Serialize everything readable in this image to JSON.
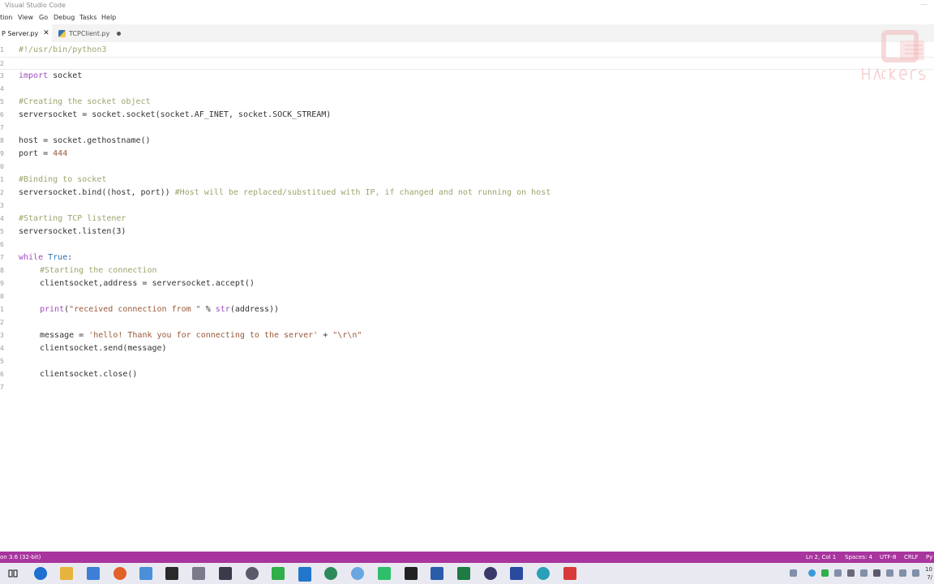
{
  "window": {
    "title": "Visual Studio Code",
    "control": "—"
  },
  "menu": [
    {
      "label": "tion"
    },
    {
      "label": "View"
    },
    {
      "label": "Go"
    },
    {
      "label": "Debug"
    },
    {
      "label": "Tasks"
    },
    {
      "label": "Help"
    }
  ],
  "tabs": [
    {
      "label": "P Server.py",
      "close": "✕",
      "active": true
    },
    {
      "label": "TCPClient.py",
      "dirty": true,
      "active": false
    }
  ],
  "editor": {
    "lines": [
      {
        "n": "1",
        "indent": 0,
        "tokens": [
          {
            "t": "#!/usr/bin/python3",
            "k": "c"
          }
        ]
      },
      {
        "n": "2",
        "indent": 0,
        "current": true,
        "tokens": []
      },
      {
        "n": "3",
        "indent": 0,
        "tokens": [
          {
            "t": "import",
            "k": "k"
          },
          {
            "t": " socket",
            "k": "p"
          }
        ]
      },
      {
        "n": "4",
        "indent": 0,
        "tokens": []
      },
      {
        "n": "5",
        "indent": 0,
        "tokens": [
          {
            "t": "#Creating the socket object",
            "k": "c"
          }
        ]
      },
      {
        "n": "6",
        "indent": 0,
        "tokens": [
          {
            "t": "serversocket = socket.socket(socket.AF_INET, socket.SOCK_STREAM)",
            "k": "p"
          }
        ]
      },
      {
        "n": "7",
        "indent": 0,
        "tokens": []
      },
      {
        "n": "8",
        "indent": 0,
        "tokens": [
          {
            "t": "host = socket.gethostname()",
            "k": "p"
          }
        ]
      },
      {
        "n": "9",
        "indent": 0,
        "tokens": [
          {
            "t": "port = ",
            "k": "p"
          },
          {
            "t": "444",
            "k": "n"
          }
        ]
      },
      {
        "n": "0",
        "indent": 0,
        "tokens": []
      },
      {
        "n": "1",
        "indent": 0,
        "tokens": [
          {
            "t": "#Binding to socket",
            "k": "c"
          }
        ]
      },
      {
        "n": "2",
        "indent": 0,
        "tokens": [
          {
            "t": "serversocket.bind((host, port)) ",
            "k": "p"
          },
          {
            "t": "#Host will be replaced/substitued with IP, if changed and not running on host",
            "k": "c"
          }
        ]
      },
      {
        "n": "3",
        "indent": 0,
        "tokens": []
      },
      {
        "n": "4",
        "indent": 0,
        "tokens": [
          {
            "t": "#Starting TCP listener",
            "k": "c"
          }
        ]
      },
      {
        "n": "5",
        "indent": 0,
        "tokens": [
          {
            "t": "serversocket.listen(3)",
            "k": "p"
          }
        ]
      },
      {
        "n": "6",
        "indent": 0,
        "tokens": []
      },
      {
        "n": "7",
        "indent": 0,
        "tokens": [
          {
            "t": "while",
            "k": "k"
          },
          {
            "t": " ",
            "k": "p"
          },
          {
            "t": "True",
            "k": "b"
          },
          {
            "t": ":",
            "k": "p"
          }
        ]
      },
      {
        "n": "8",
        "indent": 1,
        "tokens": [
          {
            "t": "#Starting the connection",
            "k": "c"
          }
        ]
      },
      {
        "n": "9",
        "indent": 1,
        "tokens": [
          {
            "t": "clientsocket,address = serversocket.accept()",
            "k": "p"
          }
        ]
      },
      {
        "n": "0",
        "indent": 1,
        "tokens": []
      },
      {
        "n": "1",
        "indent": 1,
        "tokens": [
          {
            "t": "print",
            "k": "k"
          },
          {
            "t": "(",
            "k": "p"
          },
          {
            "t": "\"received connection from \"",
            "k": "s"
          },
          {
            "t": " % ",
            "k": "p"
          },
          {
            "t": "str",
            "k": "k"
          },
          {
            "t": "(address))",
            "k": "p"
          }
        ]
      },
      {
        "n": "2",
        "indent": 1,
        "tokens": []
      },
      {
        "n": "3",
        "indent": 1,
        "tokens": [
          {
            "t": "message = ",
            "k": "p"
          },
          {
            "t": "'hello! Thank you for connecting to the server'",
            "k": "s"
          },
          {
            "t": " + ",
            "k": "p"
          },
          {
            "t": "\"\\r\\n\"",
            "k": "s"
          }
        ]
      },
      {
        "n": "4",
        "indent": 1,
        "tokens": [
          {
            "t": "clientsocket.send(message)",
            "k": "p"
          }
        ]
      },
      {
        "n": "5",
        "indent": 1,
        "tokens": []
      },
      {
        "n": "6",
        "indent": 1,
        "tokens": [
          {
            "t": "clientsocket.close()",
            "k": "p"
          }
        ]
      },
      {
        "n": "7",
        "indent": 0,
        "tokens": []
      }
    ]
  },
  "status": {
    "interpreter": "on 3.6 (32-bit)",
    "position": "Ln 2, Col 1",
    "spaces": "Spaces: 4",
    "encoding": "UTF-8",
    "eol": "CRLF",
    "language": "Py"
  },
  "taskbar": {
    "clock_time": "10",
    "clock_date": "7/"
  },
  "colors": {
    "status_bar": "#a8359e",
    "comment": "#9aa66d",
    "keyword": "#a04bbf",
    "string": "#9a5a3a",
    "builtin": "#2f6fb0",
    "watermark": "#e0a0a0"
  }
}
